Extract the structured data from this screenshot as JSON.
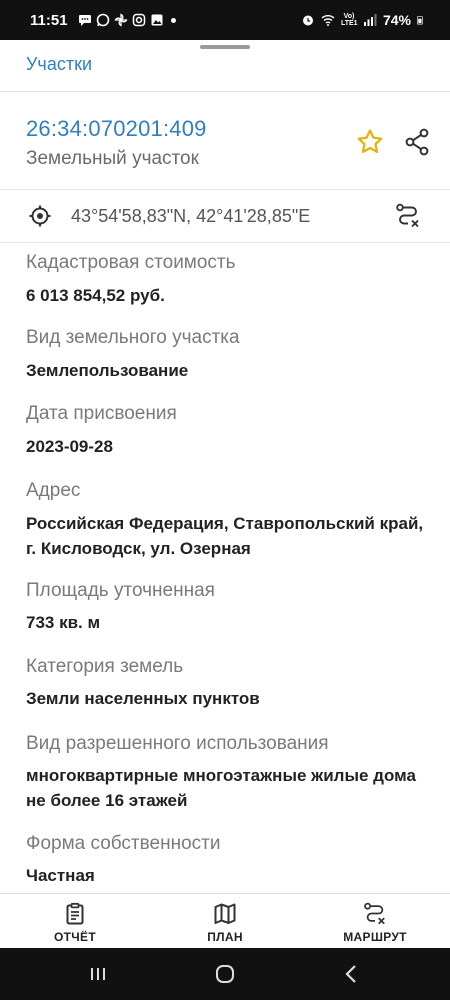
{
  "status_bar": {
    "time": "11:51",
    "battery": "74%",
    "network": "Vo) LTE1",
    "icons": [
      "chat-icon",
      "whatsapp-icon",
      "pinwheel-icon",
      "instagram-icon",
      "gallery-icon",
      "dot-icon",
      "alarm-icon",
      "wifi-icon",
      "signal-icon",
      "battery-icon"
    ]
  },
  "tab": {
    "label": "Участки"
  },
  "parcel": {
    "id": "26:34:070201:409",
    "type": "Земельный участок"
  },
  "coordinates": "43°54'58,83\"N, 42°41'28,85\"E",
  "fields": [
    {
      "label": "Кадастровая стоимость",
      "value": "6 013 854,52 руб."
    },
    {
      "label": "Вид земельного участка",
      "value": "Землепользование"
    },
    {
      "label": "Дата присвоения",
      "value": "2023-09-28"
    },
    {
      "label": "Адрес",
      "value": "Российская Федерация, Ставропольский край, г. Кисловодск, ул. Озерная"
    },
    {
      "label": "Площадь уточненная",
      "value": "733 кв. м"
    },
    {
      "label": "Категория земель",
      "value": "Земли населенных пунктов"
    },
    {
      "label": "Вид разрешенного использования",
      "value": "многоквартирные многоэтажные жилые дома не более 16 этажей"
    },
    {
      "label": "Форма собственности",
      "value": "Частная"
    }
  ],
  "bottom_nav": [
    {
      "label": "ОТЧЁТ",
      "icon": "clipboard-icon"
    },
    {
      "label": "ПЛАН",
      "icon": "map-icon"
    },
    {
      "label": "МАРШРУТ",
      "icon": "route-icon"
    }
  ],
  "colors": {
    "accent": "#2f7fc1",
    "star": "#e0b400",
    "label": "#7a7a7a",
    "value": "#222222"
  }
}
